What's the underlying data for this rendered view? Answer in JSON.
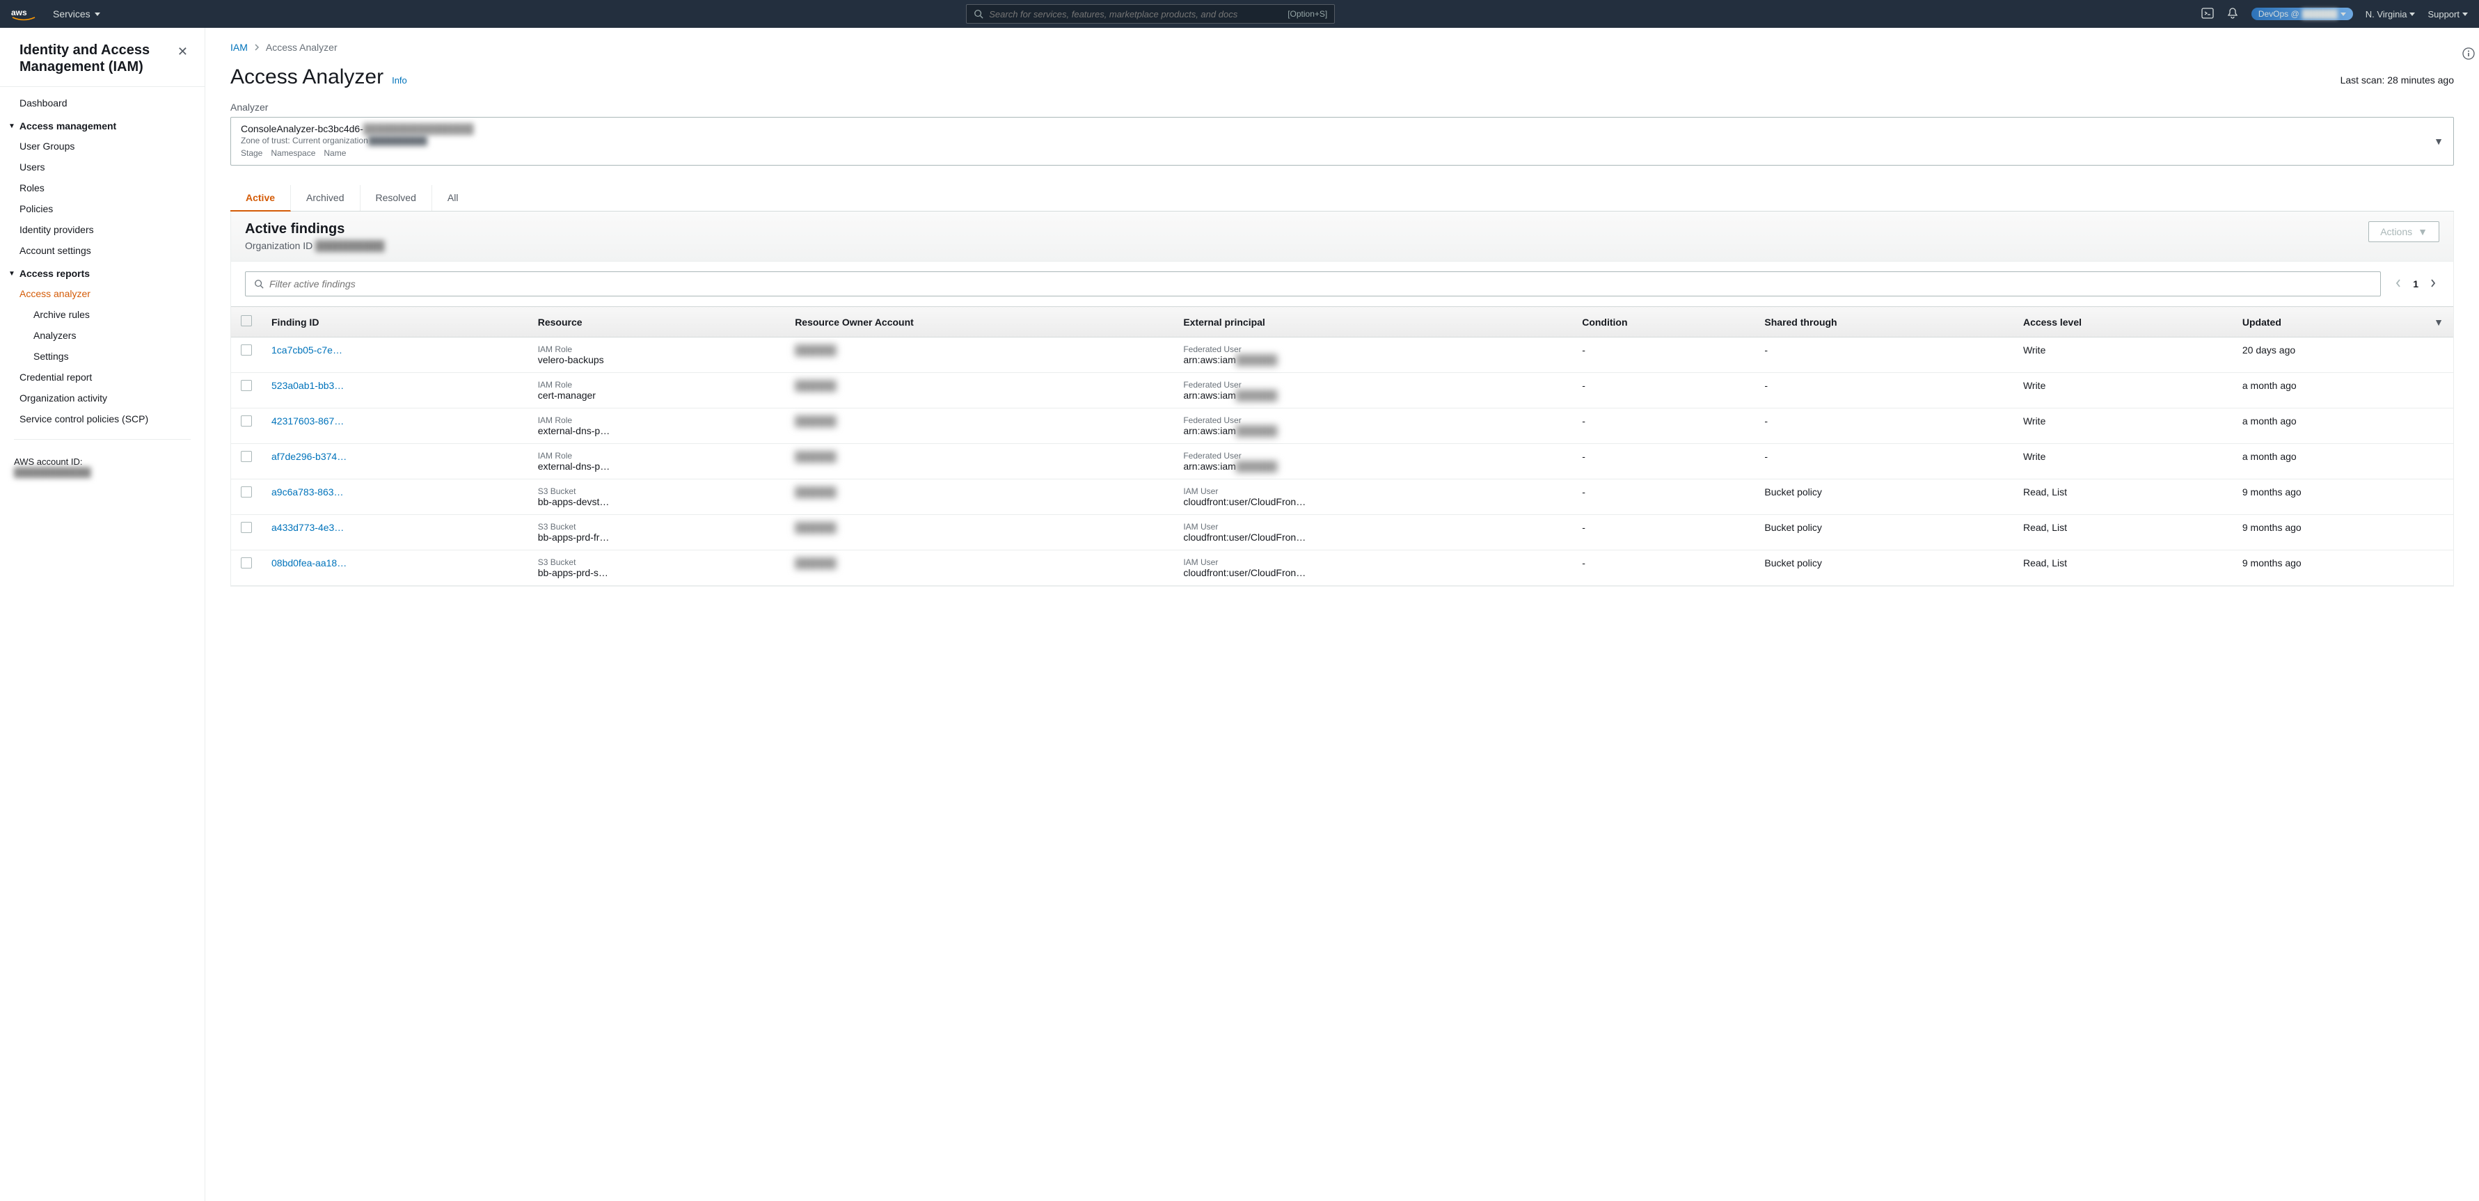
{
  "topnav": {
    "services": "Services",
    "search_placeholder": "Search for services, features, marketplace products, and docs",
    "search_shortcut": "[Option+S]",
    "account_label": "DevOps @",
    "account_blur": "██████",
    "region": "N. Virginia",
    "support": "Support"
  },
  "sidebar": {
    "title": "Identity and Access Management (IAM)",
    "dashboard": "Dashboard",
    "section_access": "Access management",
    "items_access": [
      "User Groups",
      "Users",
      "Roles",
      "Policies",
      "Identity providers",
      "Account settings"
    ],
    "section_reports": "Access reports",
    "access_analyzer": "Access analyzer",
    "sub_items": [
      "Archive rules",
      "Analyzers",
      "Settings"
    ],
    "items_reports_tail": [
      "Credential report",
      "Organization activity",
      "Service control policies (SCP)"
    ],
    "account_label": "AWS account ID:",
    "account_value": "████████████"
  },
  "breadcrumb": {
    "root": "IAM",
    "current": "Access Analyzer"
  },
  "page_title": "Access Analyzer",
  "info_link": "Info",
  "last_scan": "Last scan: 28 minutes ago",
  "analyzer_field": "Analyzer",
  "analyzer": {
    "name": "ConsoleAnalyzer-bc3bc4d6-",
    "name_blur": "████████████████",
    "sub1_label": "Zone of trust: Current organization",
    "sub1_blur": "██████████",
    "sub2": "Stage Namespace Name"
  },
  "tabs": [
    "Active",
    "Archived",
    "Resolved",
    "All"
  ],
  "panel": {
    "heading": "Active findings",
    "org_label": "Organization ID",
    "org_value": "██████████",
    "actions": "Actions",
    "filter_placeholder": "Filter active findings",
    "page_num": "1"
  },
  "columns": [
    "Finding ID",
    "Resource",
    "Resource Owner Account",
    "External principal",
    "Condition",
    "Shared through",
    "Access level",
    "Updated"
  ],
  "rows": [
    {
      "id": "1ca7cb05-c7e…",
      "res_type": "IAM Role",
      "res_name": "velero-backups",
      "owner": "██████",
      "ep_type": "Federated User",
      "ep_name": "arn:aws:iam",
      "ep_blur": "██████",
      "cond": "-",
      "shared": "-",
      "access": "Write",
      "updated": "20 days ago"
    },
    {
      "id": "523a0ab1-bb3…",
      "res_type": "IAM Role",
      "res_name": "cert-manager",
      "owner": "██████",
      "ep_type": "Federated User",
      "ep_name": "arn:aws:iam",
      "ep_blur": "██████",
      "cond": "-",
      "shared": "-",
      "access": "Write",
      "updated": "a month ago"
    },
    {
      "id": "42317603-867…",
      "res_type": "IAM Role",
      "res_name": "external-dns-p…",
      "owner": "██████",
      "ep_type": "Federated User",
      "ep_name": "arn:aws:iam",
      "ep_blur": "██████",
      "cond": "-",
      "shared": "-",
      "access": "Write",
      "updated": "a month ago"
    },
    {
      "id": "af7de296-b374…",
      "res_type": "IAM Role",
      "res_name": "external-dns-p…",
      "owner": "██████",
      "ep_type": "Federated User",
      "ep_name": "arn:aws:iam",
      "ep_blur": "██████",
      "cond": "-",
      "shared": "-",
      "access": "Write",
      "updated": "a month ago"
    },
    {
      "id": "a9c6a783-863…",
      "res_type": "S3 Bucket",
      "res_name": "bb-apps-devst…",
      "owner": "██████",
      "ep_type": "IAM User",
      "ep_name": "cloudfront:user/CloudFron…",
      "ep_blur": "",
      "cond": "-",
      "shared": "Bucket policy",
      "access": "Read, List",
      "updated": "9 months ago"
    },
    {
      "id": "a433d773-4e3…",
      "res_type": "S3 Bucket",
      "res_name": "bb-apps-prd-fr…",
      "owner": "██████",
      "ep_type": "IAM User",
      "ep_name": "cloudfront:user/CloudFron…",
      "ep_blur": "",
      "cond": "-",
      "shared": "Bucket policy",
      "access": "Read, List",
      "updated": "9 months ago"
    },
    {
      "id": "08bd0fea-aa18…",
      "res_type": "S3 Bucket",
      "res_name": "bb-apps-prd-s…",
      "owner": "██████",
      "ep_type": "IAM User",
      "ep_name": "cloudfront:user/CloudFron…",
      "ep_blur": "",
      "cond": "-",
      "shared": "Bucket policy",
      "access": "Read, List",
      "updated": "9 months ago"
    }
  ]
}
